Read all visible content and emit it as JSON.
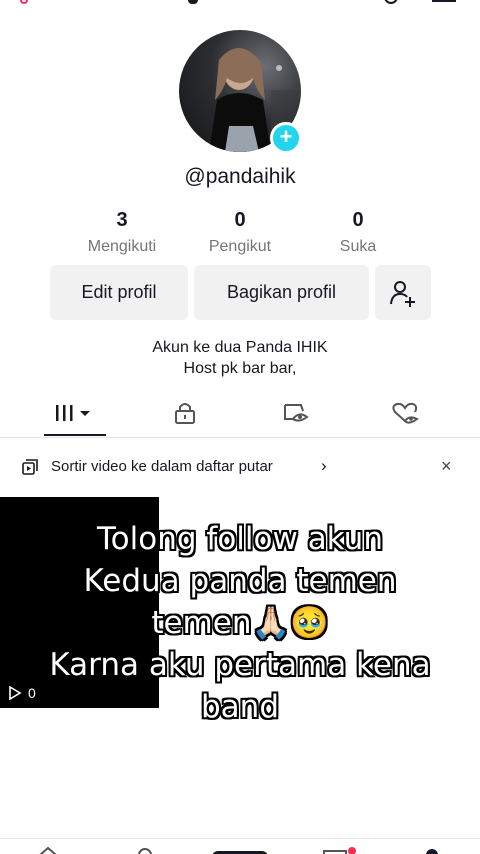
{
  "profile": {
    "username": "@pandaihik",
    "stats": [
      {
        "value": "3",
        "label": "Mengikuti"
      },
      {
        "value": "0",
        "label": "Pengikut"
      },
      {
        "value": "0",
        "label": "Suka"
      }
    ],
    "buttons": {
      "edit": "Edit profil",
      "share": "Bagikan profil"
    },
    "bio": {
      "line1": "Akun ke dua Panda IHIK",
      "line2": "Host pk bar bar,"
    }
  },
  "tabs": [
    {
      "name": "videos",
      "icon": "grid-icon",
      "active": true
    },
    {
      "name": "private",
      "icon": "lock-icon",
      "active": false
    },
    {
      "name": "reposts",
      "icon": "eye-off-icon",
      "active": false
    },
    {
      "name": "liked",
      "icon": "heart-off-icon",
      "active": false
    }
  ],
  "sort_banner": {
    "text": "Sortir video ke dalam daftar putar",
    "chevron": "›",
    "close": "×"
  },
  "video": {
    "views": "0"
  },
  "caption": {
    "line1": "Tolong follow akun",
    "line2": "Kedua panda temen",
    "line3": "temen🙏🏻🥹",
    "line4": "Karna aku pertama kena",
    "line5": "band"
  },
  "colors": {
    "accent": "#20d5ec",
    "brand": "#fe2c55",
    "button_bg": "#f1f1f2",
    "text": "#161823",
    "muted": "#757575"
  }
}
